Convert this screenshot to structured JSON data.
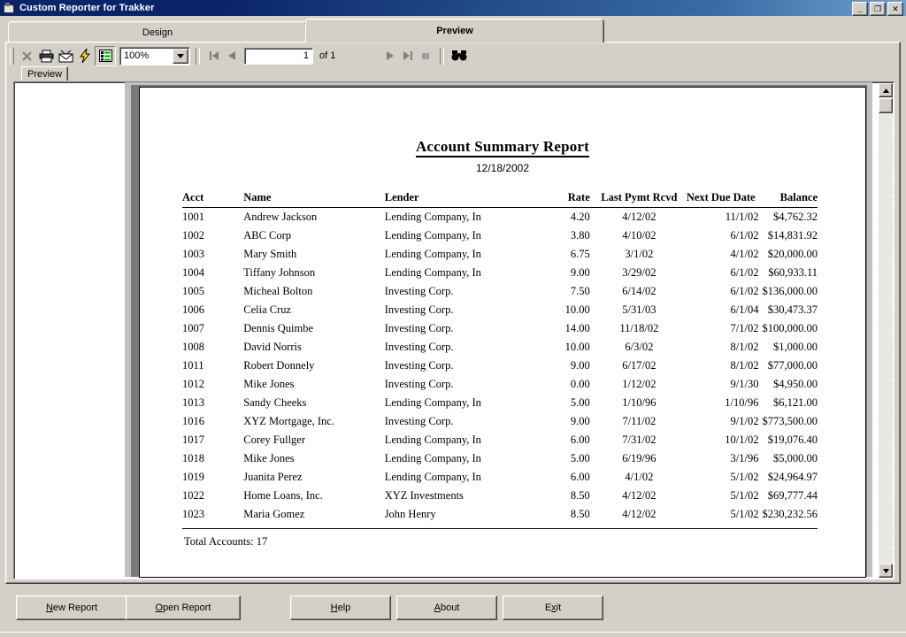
{
  "window": {
    "title": "Custom Reporter for Trakker",
    "icon": "report-app-icon",
    "minimize_label": "_",
    "restore_label": "❐",
    "close_label": "✕"
  },
  "tabs": [
    {
      "id": "design",
      "label": "Design",
      "active": false
    },
    {
      "id": "preview",
      "label": "Preview",
      "active": true
    }
  ],
  "toolbar": {
    "close_icon": "✕",
    "print_icon": "printer-icon",
    "mail_icon": "envelope-icon",
    "export_icon": "lightning-bolt-icon",
    "outline_icon": "outline-view-icon",
    "zoom_value": "100%",
    "zoom_arrow": "▼",
    "first_page_icon": "⏮",
    "prev_page_icon": "◀",
    "page_number": "1",
    "page_of": "of 1",
    "next_page_icon": "▶",
    "last_page_icon": "⏭",
    "stop_icon": "■",
    "find_icon": "binoculars-icon"
  },
  "subtab": {
    "label": "Preview"
  },
  "report": {
    "title": "Account Summary Report",
    "date": "12/18/2002",
    "columns": [
      "Acct",
      "Name",
      "Lender",
      "Rate",
      "Last Pymt Rcvd",
      "Next Due Date",
      "Balance"
    ],
    "rows": [
      [
        "1001",
        "Andrew Jackson",
        "Lending Company, In",
        "4.20",
        "4/12/02",
        "11/1/02",
        "$4,762.32"
      ],
      [
        "1002",
        " ABC Corp",
        "Lending Company, In",
        "3.80",
        "4/10/02",
        "6/1/02",
        "$14,831.92"
      ],
      [
        "1003",
        "Mary Smith",
        "Lending Company, In",
        "6.75",
        "3/1/02",
        "4/1/02",
        "$20,000.00"
      ],
      [
        "1004",
        "Tiffany Johnson",
        "Lending Company, In",
        "9.00",
        "3/29/02",
        "6/1/02",
        "$60,933.11"
      ],
      [
        "1005",
        "Micheal Bolton",
        "Investing Corp.",
        "7.50",
        "6/14/02",
        "6/1/02",
        "$136,000.00"
      ],
      [
        "1006",
        "Celia Cruz",
        "Investing Corp.",
        "10.00",
        "5/31/03",
        "6/1/04",
        "$30,473.37"
      ],
      [
        "1007",
        "Dennis Quimbe",
        "Investing Corp.",
        "14.00",
        "11/18/02",
        "7/1/02",
        "$100,000.00"
      ],
      [
        "1008",
        "David Norris",
        "Investing Corp.",
        "10.00",
        "6/3/02",
        "8/1/02",
        "$1,000.00"
      ],
      [
        "1011",
        "Robert Donnely",
        "Investing Corp.",
        "9.00",
        "6/17/02",
        "8/1/02",
        "$77,000.00"
      ],
      [
        "1012",
        "Mike Jones",
        "Investing Corp.",
        "0.00",
        "1/12/02",
        "9/1/30",
        "$4,950.00"
      ],
      [
        "1013",
        "Sandy Cheeks",
        "Lending Company, In",
        "5.00",
        "1/10/96",
        "1/10/96",
        "$6,121.00"
      ],
      [
        "1016",
        " XYZ Mortgage, Inc.",
        "Investing Corp.",
        "9.00",
        "7/11/02",
        "9/1/02",
        "$773,500.00"
      ],
      [
        "1017",
        "Corey Fullger",
        "Lending Company, In",
        "6.00",
        "7/31/02",
        "10/1/02",
        "$19,076.40"
      ],
      [
        "1018",
        "Mike Jones",
        "Lending Company, In",
        "5.00",
        "6/19/96",
        "3/1/96",
        "$5,000.00"
      ],
      [
        "1019",
        "Juanita Perez",
        "Lending Company, In",
        "6.00",
        "4/1/02",
        "5/1/02",
        "$24,964.97"
      ],
      [
        "1022",
        " Home Loans, Inc.",
        "XYZ Investments",
        "8.50",
        "4/12/02",
        "5/1/02",
        "$69,777.44"
      ],
      [
        "1023",
        "Maria Gomez",
        "John Henry",
        "8.50",
        "4/12/02",
        "5/1/02",
        "$230,232.56"
      ]
    ],
    "total_label": "Total Accounts:  17"
  },
  "scrollbar": {
    "up_arrow": "▲",
    "down_arrow": "▼"
  },
  "buttons": [
    {
      "id": "new-report",
      "pre": "",
      "acc": "N",
      "post": "ew Report"
    },
    {
      "id": "open-report",
      "pre": "",
      "acc": "O",
      "post": "pen Report"
    },
    {
      "id": "help",
      "pre": "",
      "acc": "H",
      "post": "elp"
    },
    {
      "id": "about",
      "pre": "",
      "acc": "A",
      "post": "bout"
    },
    {
      "id": "exit",
      "pre": "E",
      "acc": "x",
      "post": "it"
    }
  ]
}
